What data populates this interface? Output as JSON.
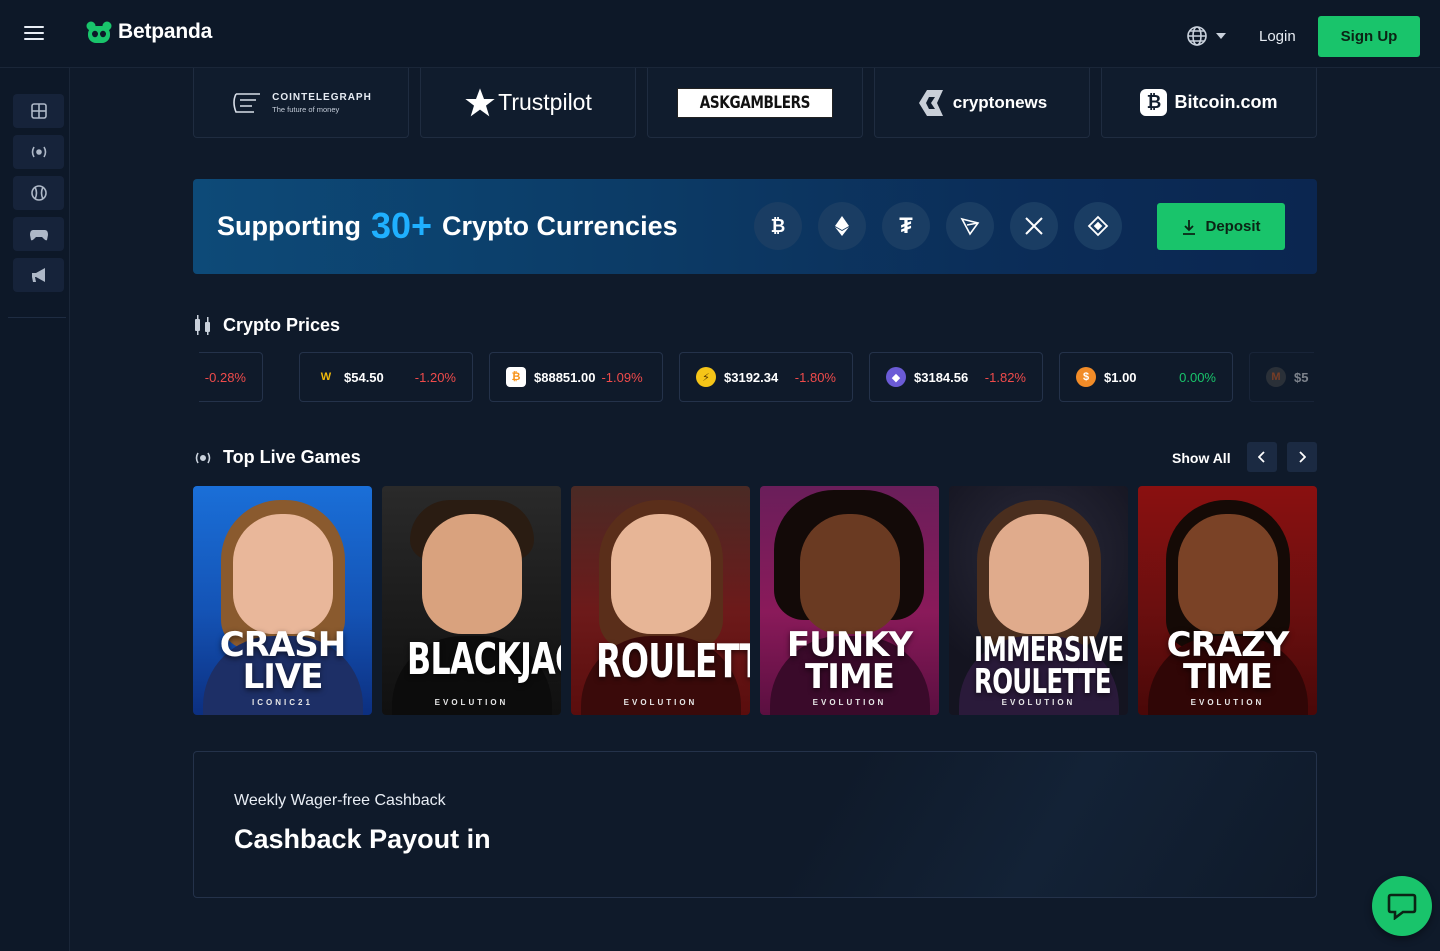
{
  "header": {
    "brand": "Betpanda",
    "login_label": "Login",
    "signup_label": "Sign Up"
  },
  "partners": [
    {
      "name": "COINTELEGRAPH",
      "tagline": "The future of money"
    },
    {
      "name": "Trustpilot"
    },
    {
      "name": "ASKGAMBLERS"
    },
    {
      "name": "cryptonews"
    },
    {
      "name": "Bitcoin.com"
    }
  ],
  "banner": {
    "prefix": "Supporting",
    "number": "30+",
    "suffix": "Crypto Currencies",
    "deposit_label": "Deposit",
    "coins": [
      "bitcoin-icon",
      "ethereum-icon",
      "tether-icon",
      "tron-icon",
      "xrp-icon",
      "bnb-icon"
    ]
  },
  "crypto_prices": {
    "title": "Crypto Prices",
    "items": [
      {
        "value": "",
        "change": "-0.28%",
        "trend": "neg"
      },
      {
        "value": "$54.50",
        "change": "-1.20%",
        "trend": "neg"
      },
      {
        "value": "$88851.00",
        "change": "-1.09%",
        "trend": "neg"
      },
      {
        "value": "$3192.34",
        "change": "-1.80%",
        "trend": "neg"
      },
      {
        "value": "$3184.56",
        "change": "-1.82%",
        "trend": "neg"
      },
      {
        "value": "$1.00",
        "change": "0.00%",
        "trend": "pos"
      },
      {
        "value": "$5",
        "change": "",
        "trend": "neg"
      }
    ]
  },
  "live_games": {
    "title": "Top Live Games",
    "show_all": "Show All",
    "games": [
      {
        "title_line1": "CRASH",
        "title_line2": "LIVE",
        "provider": "ICONIC21"
      },
      {
        "title_line1": "BLACKJACK",
        "title_line2": "",
        "provider": "EVOLUTION"
      },
      {
        "title_line1": "ROULETTE",
        "title_line2": "",
        "provider": "EVOLUTION"
      },
      {
        "title_line1": "FUNKY",
        "title_line2": "TIME",
        "provider": "EVOLUTION"
      },
      {
        "title_line1": "IMMERSIVE",
        "title_line2": "ROULETTE",
        "provider": "EVOLUTION"
      },
      {
        "title_line1": "CRAZY",
        "title_line2": "TIME",
        "provider": "EVOLUTION"
      }
    ]
  },
  "cashback": {
    "subtitle": "Weekly Wager-free Cashback",
    "title": "Cashback Payout in"
  },
  "colors": {
    "accent_green": "#19c46b",
    "accent_blue": "#1fb0ff",
    "negative": "#ef4b4b",
    "background": "#0f1a2a"
  }
}
